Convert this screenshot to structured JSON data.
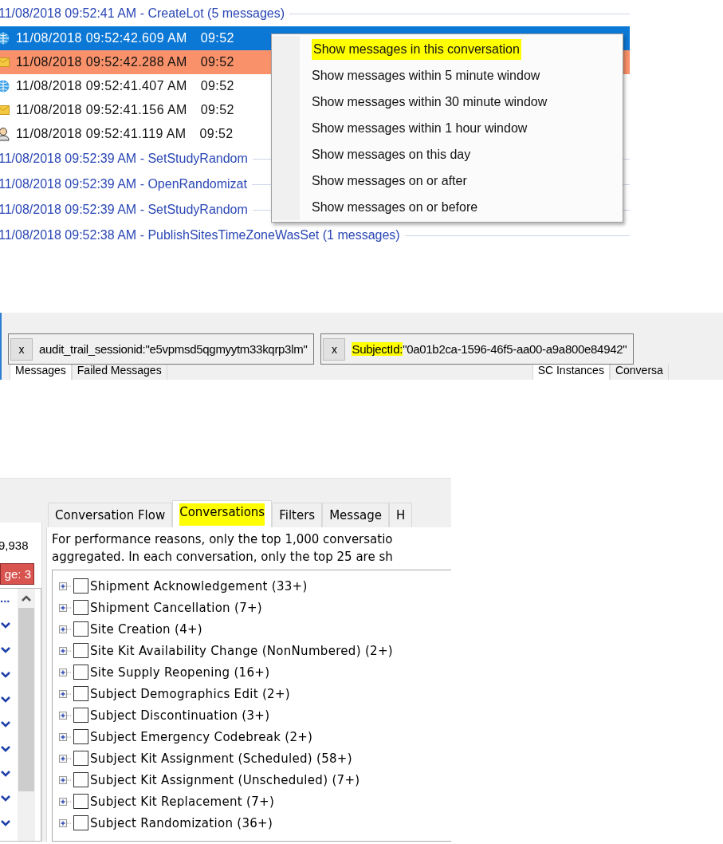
{
  "log": {
    "entries": [
      {
        "kind": "group",
        "text": "11/08/2018 09:52:41 AM - CreateLot (5 messages)"
      },
      {
        "kind": "service",
        "selected": true,
        "error": false,
        "time": "11/08/2018 09:52:42.609 AM",
        "time_2": "09:52"
      },
      {
        "kind": "mail",
        "selected": false,
        "error": true,
        "time": "11/08/2018 09:52:42.288 AM",
        "time_2": "09:52"
      },
      {
        "kind": "service",
        "selected": false,
        "error": false,
        "time": "11/08/2018 09:52:41.407 AM",
        "time_2": "09:52"
      },
      {
        "kind": "mail",
        "selected": false,
        "error": false,
        "time": "11/08/2018 09:52:41.156 AM",
        "time_2": "09:52"
      },
      {
        "kind": "user",
        "selected": false,
        "error": false,
        "time": "11/08/2018 09:52:41.119 AM",
        "time_2": "09:52"
      },
      {
        "kind": "group",
        "text": "11/08/2018 09:52:39 AM - SetStudyRandom"
      },
      {
        "kind": "group",
        "text": "11/08/2018 09:52:39 AM - OpenRandomizat"
      },
      {
        "kind": "group",
        "text": "11/08/2018 09:52:39 AM - SetStudyRandom"
      },
      {
        "kind": "group",
        "text": "11/08/2018 09:52:38 AM - PublishSitesTimeZoneWasSet (1 messages)"
      }
    ],
    "context_menu": [
      {
        "label": "Show messages in this conversation",
        "highlighted": true
      },
      {
        "label": "Show messages within 5 minute window",
        "highlighted": false
      },
      {
        "label": "Show messages within 30 minute window",
        "highlighted": false
      },
      {
        "label": "Show messages within 1 hour window",
        "highlighted": false
      },
      {
        "label": "Show messages on this day",
        "highlighted": false
      },
      {
        "label": "Show messages on or after",
        "highlighted": false
      },
      {
        "label": "Show messages on or before",
        "highlighted": false
      }
    ]
  },
  "filter_bar": {
    "filters": [
      {
        "remove": "x",
        "key": "audit_trail_sessionid:",
        "value": "\"e5vpmsd5qgmyytm33kqrp3lm\"",
        "highlighted": false
      },
      {
        "remove": "x",
        "key": "SubjectId:",
        "value": "\"0a01b2ca-1596-46f5-aa00-a9a800e84942\"",
        "highlighted": true
      }
    ],
    "left_tabs": [
      {
        "label": "Messages",
        "selected": true
      },
      {
        "label": "Failed Messages",
        "selected": false
      }
    ],
    "right_tabs": [
      {
        "label": "SC Instances",
        "selected": true
      },
      {
        "label": "Conversa",
        "selected": false
      }
    ]
  },
  "conversations_panel": {
    "left_pane": {
      "count": "9,938",
      "badge": "ge: 3",
      "list_header": "..."
    },
    "tabs": [
      {
        "label": "Conversation Flow",
        "selected": false,
        "highlighted": false
      },
      {
        "label": "Conversations",
        "selected": true,
        "highlighted": true
      },
      {
        "label": "Filters",
        "selected": false,
        "highlighted": false
      },
      {
        "label": "Message",
        "selected": false,
        "highlighted": false
      },
      {
        "label": "H",
        "selected": false,
        "highlighted": false
      }
    ],
    "notice": [
      "For performance reasons, only the top 1,000 conversatio",
      "aggregated. In each conversation, only the top 25 are sh"
    ],
    "tree": [
      {
        "label": "Shipment Acknowledgement (33+)",
        "checked": false,
        "expanded": false
      },
      {
        "label": "Shipment Cancellation (7+)",
        "checked": false,
        "expanded": false
      },
      {
        "label": "Site Creation (4+)",
        "checked": false,
        "expanded": false
      },
      {
        "label": "Site Kit Availability Change (NonNumbered) (2+)",
        "checked": false,
        "expanded": false
      },
      {
        "label": "Site Supply Reopening (16+)",
        "checked": false,
        "expanded": false
      },
      {
        "label": "Subject Demographics Edit (2+)",
        "checked": false,
        "expanded": false
      },
      {
        "label": "Subject Discontinuation (3+)",
        "checked": false,
        "expanded": false
      },
      {
        "label": "Subject Emergency Codebreak (2+)",
        "checked": false,
        "expanded": false
      },
      {
        "label": "Subject Kit Assignment (Scheduled) (58+)",
        "checked": false,
        "expanded": false
      },
      {
        "label": "Subject Kit Assignment (Unscheduled) (7+)",
        "checked": false,
        "expanded": false
      },
      {
        "label": "Subject Kit Replacement (7+)",
        "checked": false,
        "expanded": false
      },
      {
        "label": "Subject Randomization (36+)",
        "checked": false,
        "expanded": false
      }
    ]
  }
}
